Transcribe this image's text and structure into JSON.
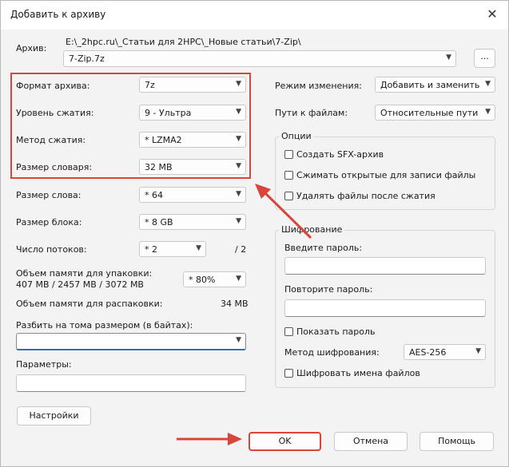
{
  "window": {
    "title": "Добавить к архиву",
    "close_glyph": "✕"
  },
  "archive": {
    "label": "Архив:",
    "path": "E:\\_2hpc.ru\\_Статьи для 2HPC\\_Новые статьи\\7-Zip\\",
    "filename": "7-Zip.7z",
    "browse_label": "..."
  },
  "left": {
    "format_label": "Формат архива:",
    "format_value": "7z",
    "level_label": "Уровень сжатия:",
    "level_value": "9 - Ультра",
    "method_label": "Метод сжатия:",
    "method_value": "*  LZMA2",
    "dict_label": "Размер словаря:",
    "dict_value": "32 MB",
    "word_label": "Размер слова:",
    "word_value": "*  64",
    "block_label": "Размер блока:",
    "block_value": "*  8 GB",
    "threads_label": "Число потоков:",
    "threads_value": "*  2",
    "threads_max": "/ 2",
    "mem_pack_label": "Объем памяти для упаковки:",
    "mem_pack_value": "407 MB / 2457 MB / 3072 MB",
    "mem_pack_select": "*  80%",
    "mem_unpack_label": "Объем памяти для распаковки:",
    "mem_unpack_value": "34 MB",
    "split_label": "Разбить на тома размером (в байтах):",
    "split_value": "",
    "params_label": "Параметры:",
    "params_value": "",
    "settings_button": "Настройки"
  },
  "right": {
    "update_label": "Режим изменения:",
    "update_value": "Добавить и заменить",
    "paths_label": "Пути к файлам:",
    "paths_value": "Относительные пути",
    "options_title": "Опции",
    "options": [
      "Создать SFX-архив",
      "Сжимать открытые для записи файлы",
      "Удалять файлы после сжатия"
    ],
    "encryption_title": "Шифрование",
    "password_label": "Введите пароль:",
    "password_repeat_label": "Повторите пароль:",
    "show_password": "Показать пароль",
    "enc_method_label": "Метод шифрования:",
    "enc_method_value": "AES-256",
    "encrypt_names": "Шифровать имена файлов"
  },
  "buttons": {
    "ok": "OK",
    "cancel": "Отмена",
    "help": "Помощь"
  },
  "colors": {
    "highlight": "#d9443b"
  },
  "icons": {
    "dropdown": "▼",
    "spinner_up": "▲",
    "spinner_down": "▼"
  }
}
